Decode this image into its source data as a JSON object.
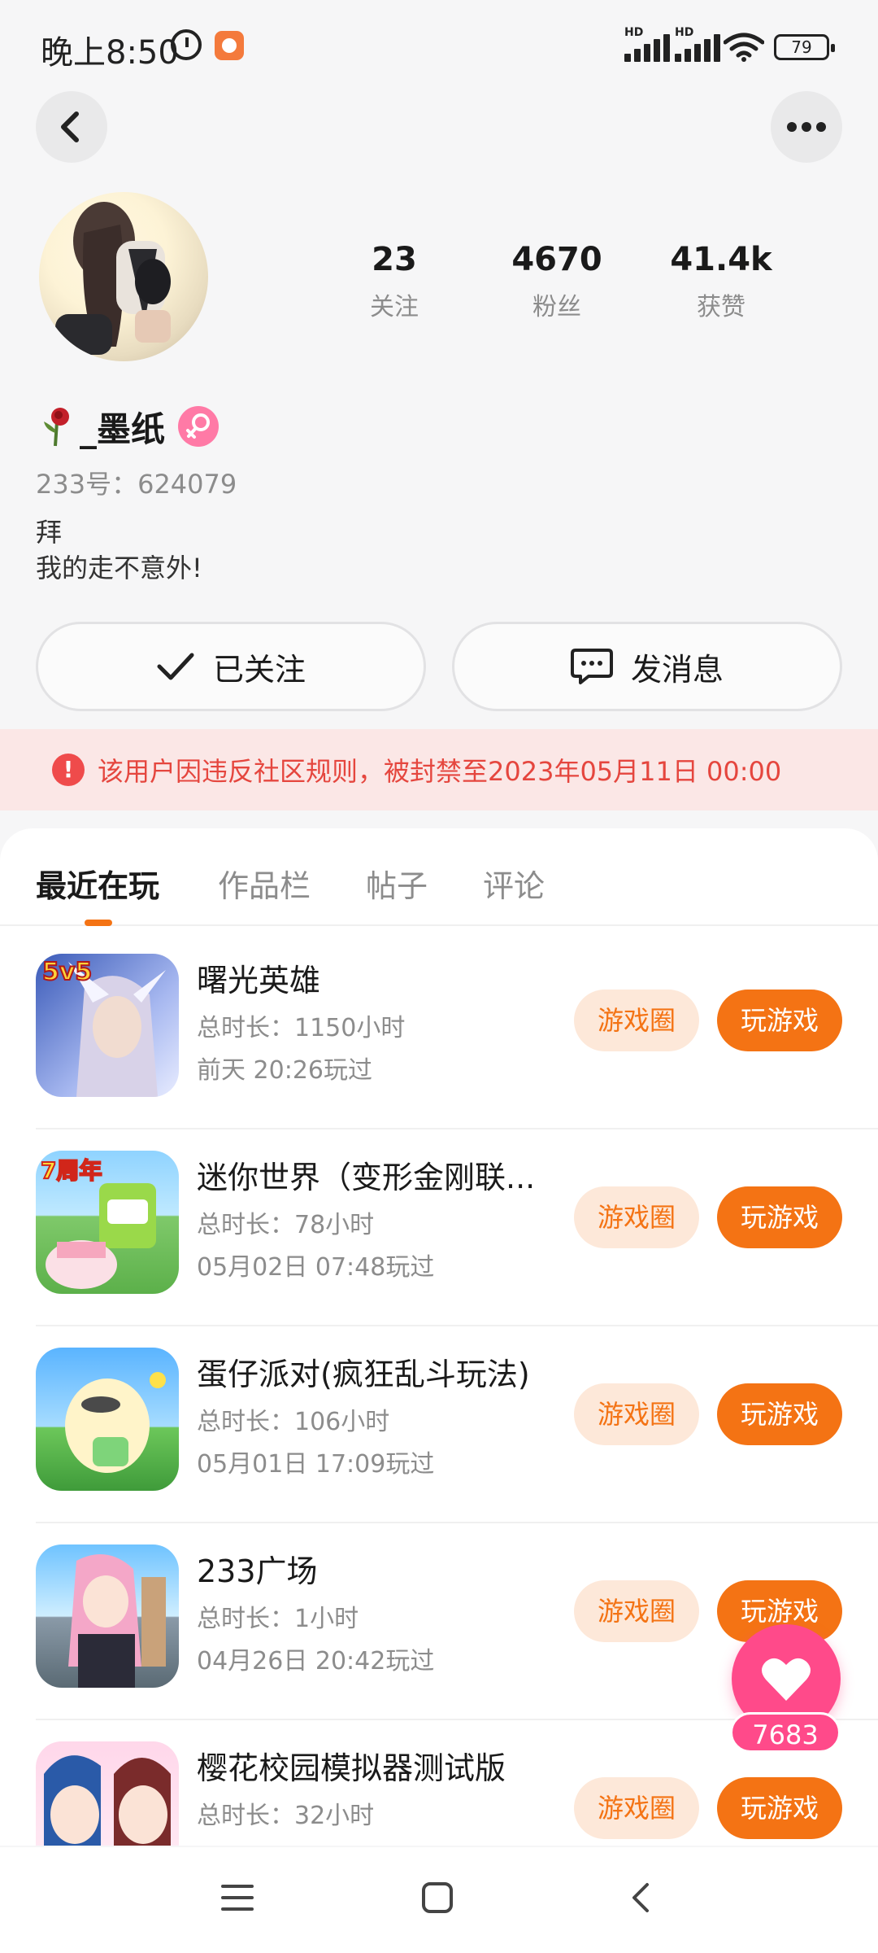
{
  "status_bar": {
    "time": "晚上8:50",
    "battery": "79"
  },
  "profile": {
    "stats": [
      {
        "value": "23",
        "label": "关注"
      },
      {
        "value": "4670",
        "label": "粉丝"
      },
      {
        "value": "41.4k",
        "label": "获赞"
      }
    ],
    "name": "_墨纸",
    "uid": "233号：624079",
    "bio_line1": "拜",
    "bio_line2": "我的走不意外!",
    "follow_label": "已关注",
    "message_label": "发消息"
  },
  "ban_notice": "该用户因违反社区规则，被封禁至2023年05月11日 00:00",
  "tabs": [
    "最近在玩",
    "作品栏",
    "帖子",
    "评论"
  ],
  "games": [
    {
      "title": "曙光英雄",
      "duration": "总时长：1150小时",
      "last_played": "前天 20:26玩过",
      "circle_label": "游戏圈",
      "play_label": "玩游戏"
    },
    {
      "title": "迷你世界（变形金刚联...",
      "duration": "总时长：78小时",
      "last_played": "05月02日 07:48玩过",
      "circle_label": "游戏圈",
      "play_label": "玩游戏"
    },
    {
      "title": "蛋仔派对(疯狂乱斗玩法)",
      "duration": "总时长：106小时",
      "last_played": "05月01日 17:09玩过",
      "circle_label": "游戏圈",
      "play_label": "玩游戏"
    },
    {
      "title": "233广场",
      "duration": "总时长：1小时",
      "last_played": "04月26日 20:42玩过",
      "circle_label": "游戏圈",
      "play_label": "玩游戏"
    },
    {
      "title": "樱花校园模拟器测试版",
      "duration": "总时长：32小时",
      "last_played": "",
      "circle_label": "游戏圈",
      "play_label": "玩游戏"
    }
  ],
  "like_count": "7683",
  "colors": {
    "accent": "#f47314",
    "accent_light": "#fde8d9",
    "ban_bg": "#fbe7e6",
    "ban_text": "#e5463e",
    "like": "#ff4a8a"
  }
}
